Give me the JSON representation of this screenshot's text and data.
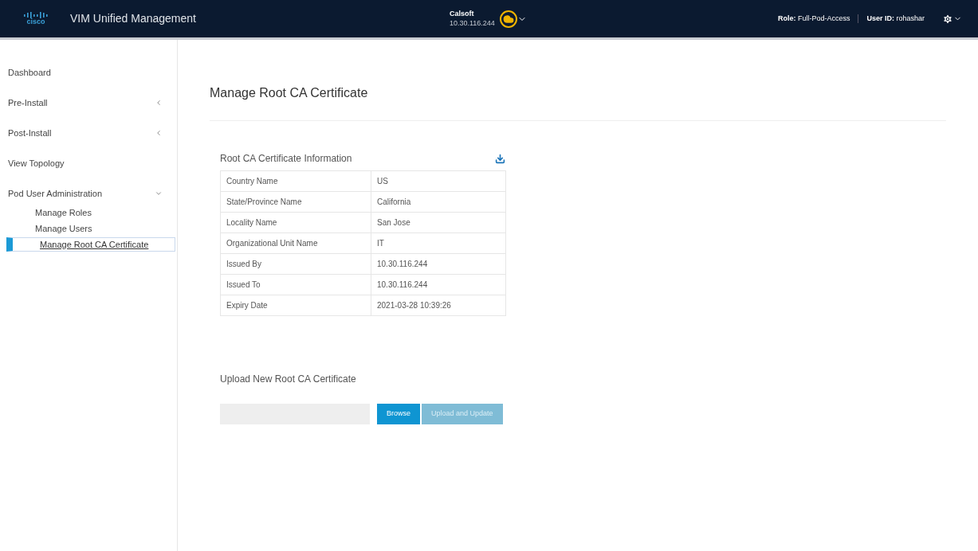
{
  "header": {
    "logo_text": "cisco",
    "title": "VIM Unified Management",
    "pod": {
      "name": "Calsoft",
      "address": "10.30.116.244"
    },
    "role_label": "Role:",
    "role": "Full-Pod-Access",
    "user_label": "User ID:",
    "user": "rohashar"
  },
  "sidebar": {
    "items": [
      {
        "label": "Dashboard",
        "selected": false
      },
      {
        "label": "Pre-Install",
        "selected": false,
        "expanded": false
      },
      {
        "label": "Post-Install",
        "selected": false,
        "expanded": false
      },
      {
        "label": "View Topology",
        "selected": false
      },
      {
        "label": "Pod User Administration",
        "selected": false,
        "expanded": true,
        "children": [
          {
            "label": "Manage Roles",
            "selected": false
          },
          {
            "label": "Manage Users",
            "selected": false
          },
          {
            "label": "Manage Root CA Certificate",
            "selected": true
          }
        ]
      }
    ]
  },
  "page_title": "Manage Root CA Certificate",
  "info": {
    "title": "Root CA Certificate Information",
    "rows": [
      {
        "label": "Country Name",
        "value": "US"
      },
      {
        "label": "State/Province Name",
        "value": "California"
      },
      {
        "label": "Locality Name",
        "value": "San Jose"
      },
      {
        "label": "Organizational Unit Name",
        "value": "IT"
      },
      {
        "label": "Issued By",
        "value": "10.30.116.244"
      },
      {
        "label": "Issued To",
        "value": "10.30.116.244"
      },
      {
        "label": "Expiry Date",
        "value": "2021-03-28 10:39:26"
      }
    ]
  },
  "upload": {
    "title": "Upload New Root CA Certificate",
    "buttons": [
      {
        "label": "Browse",
        "disabled": false
      },
      {
        "label": "Upload and Update",
        "disabled": true
      }
    ]
  }
}
